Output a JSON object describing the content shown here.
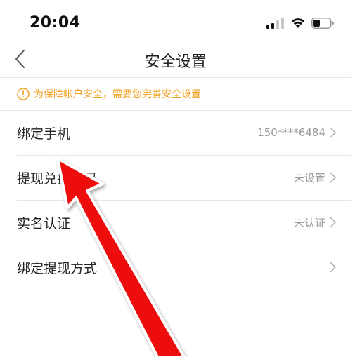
{
  "status_bar": {
    "time": "20:04",
    "icons": [
      "cellular-signal-icon",
      "wifi-icon",
      "battery-icon"
    ]
  },
  "nav": {
    "title": "安全设置",
    "back_icon": "chevron-left-icon"
  },
  "notice": {
    "icon": "info-circle-icon",
    "text": "为保障帐户安全，需要您完善安全设置",
    "color": "#f0a020"
  },
  "rows": [
    {
      "label": "绑定手机",
      "value": "150****6484"
    },
    {
      "label": "提现兑换密码",
      "value": "未设置"
    },
    {
      "label": "实名认证",
      "value": "未认证"
    },
    {
      "label": "绑定提现方式",
      "value": ""
    }
  ],
  "annotation": {
    "type": "red-arrow",
    "color": "#ee1111"
  }
}
